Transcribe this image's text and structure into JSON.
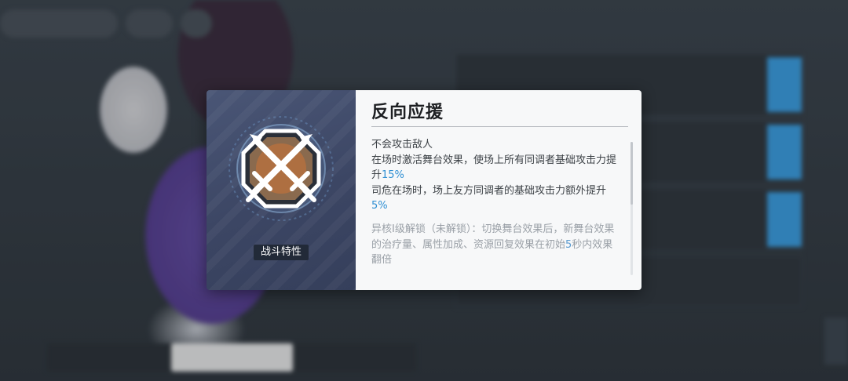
{
  "popup": {
    "category_label": "战斗特性",
    "title": "反向应援",
    "description": {
      "line1": "不会攻击敌人",
      "line2_prefix": "在场时激活舞台效果，使场上所有同调者基础攻击力提升",
      "line2_value": "15%",
      "line3_prefix": "司危在场时，场上友方同调者的基础攻击力额外提升",
      "line3_value": "5%",
      "unlock_prefix": "异核I级解锁（未解锁）：切换舞台效果后，新舞台效果的治疗量、属性加成、资源回复效果在初始",
      "unlock_value": "5",
      "unlock_suffix": "秒内效果翻倍"
    },
    "icon": "crossed-swords-icon"
  },
  "colors": {
    "highlight": "#2f8fd3",
    "accent_plus": "#3aa2e8"
  }
}
